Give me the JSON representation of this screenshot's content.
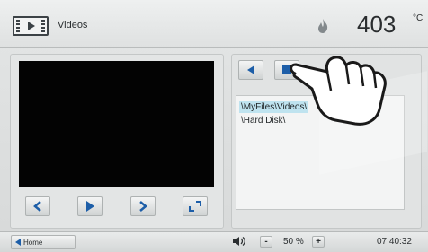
{
  "header": {
    "title": "Videos",
    "icon": "video-icon",
    "temperature": "403",
    "temperature_unit": "°C"
  },
  "file_list": {
    "items": [
      {
        "label": "\\MyFiles\\Videos\\",
        "selected": true
      },
      {
        "label": "\\Hard Disk\\",
        "selected": false
      }
    ]
  },
  "playback_controls": [
    "previous-icon",
    "play-icon",
    "next-icon",
    "fullscreen-icon"
  ],
  "nav_buttons": [
    "back-icon",
    "stop-icon"
  ],
  "footer": {
    "home_label": "Home",
    "volume_minus": "-",
    "volume": "50 %",
    "volume_plus": "+",
    "clock": "07:40:32"
  },
  "colors": {
    "accent": "#1d5ea8",
    "selection": "#bfe3ef",
    "video_bg": "#030303"
  }
}
